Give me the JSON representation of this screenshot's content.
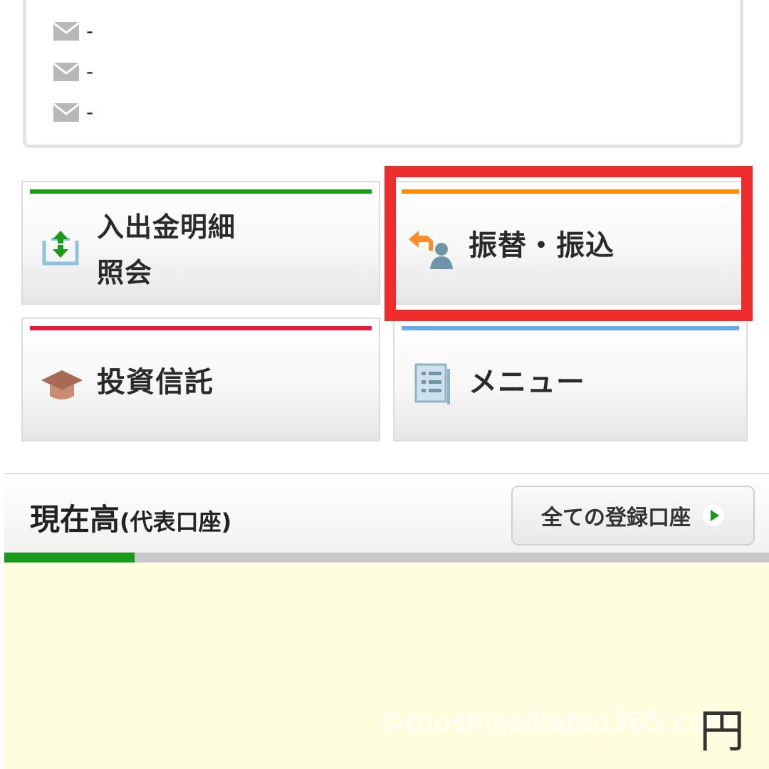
{
  "notice": {
    "rows": [
      {
        "icon": "mail-icon",
        "text": "-"
      },
      {
        "icon": "mail-icon",
        "text": "-"
      },
      {
        "icon": "mail-icon",
        "text": "-"
      }
    ]
  },
  "tiles": {
    "history": {
      "label_line1": "入出金明細",
      "label_line2": "照会",
      "icon": "deposit-withdrawal-icon",
      "accent": "#1a9a1a"
    },
    "transfer": {
      "label": "振替・振込",
      "icon": "transfer-person-icon",
      "accent": "#ff8c00"
    },
    "fund": {
      "label": "投資信託",
      "icon": "mortarboard-icon",
      "accent": "#e8193c"
    },
    "menu": {
      "label": "メニュー",
      "icon": "menu-list-icon",
      "accent": "#6aaae8"
    }
  },
  "highlight_color": "#f02b2b",
  "balance": {
    "title": "現在高",
    "title_sub": "(代表口座)",
    "all_accounts_label": "全ての登録口座",
    "progress_fraction": 0.17,
    "currency": "円",
    "watermark": "©toushiseikatsu365.com",
    "panel_color": "#fefedf"
  }
}
